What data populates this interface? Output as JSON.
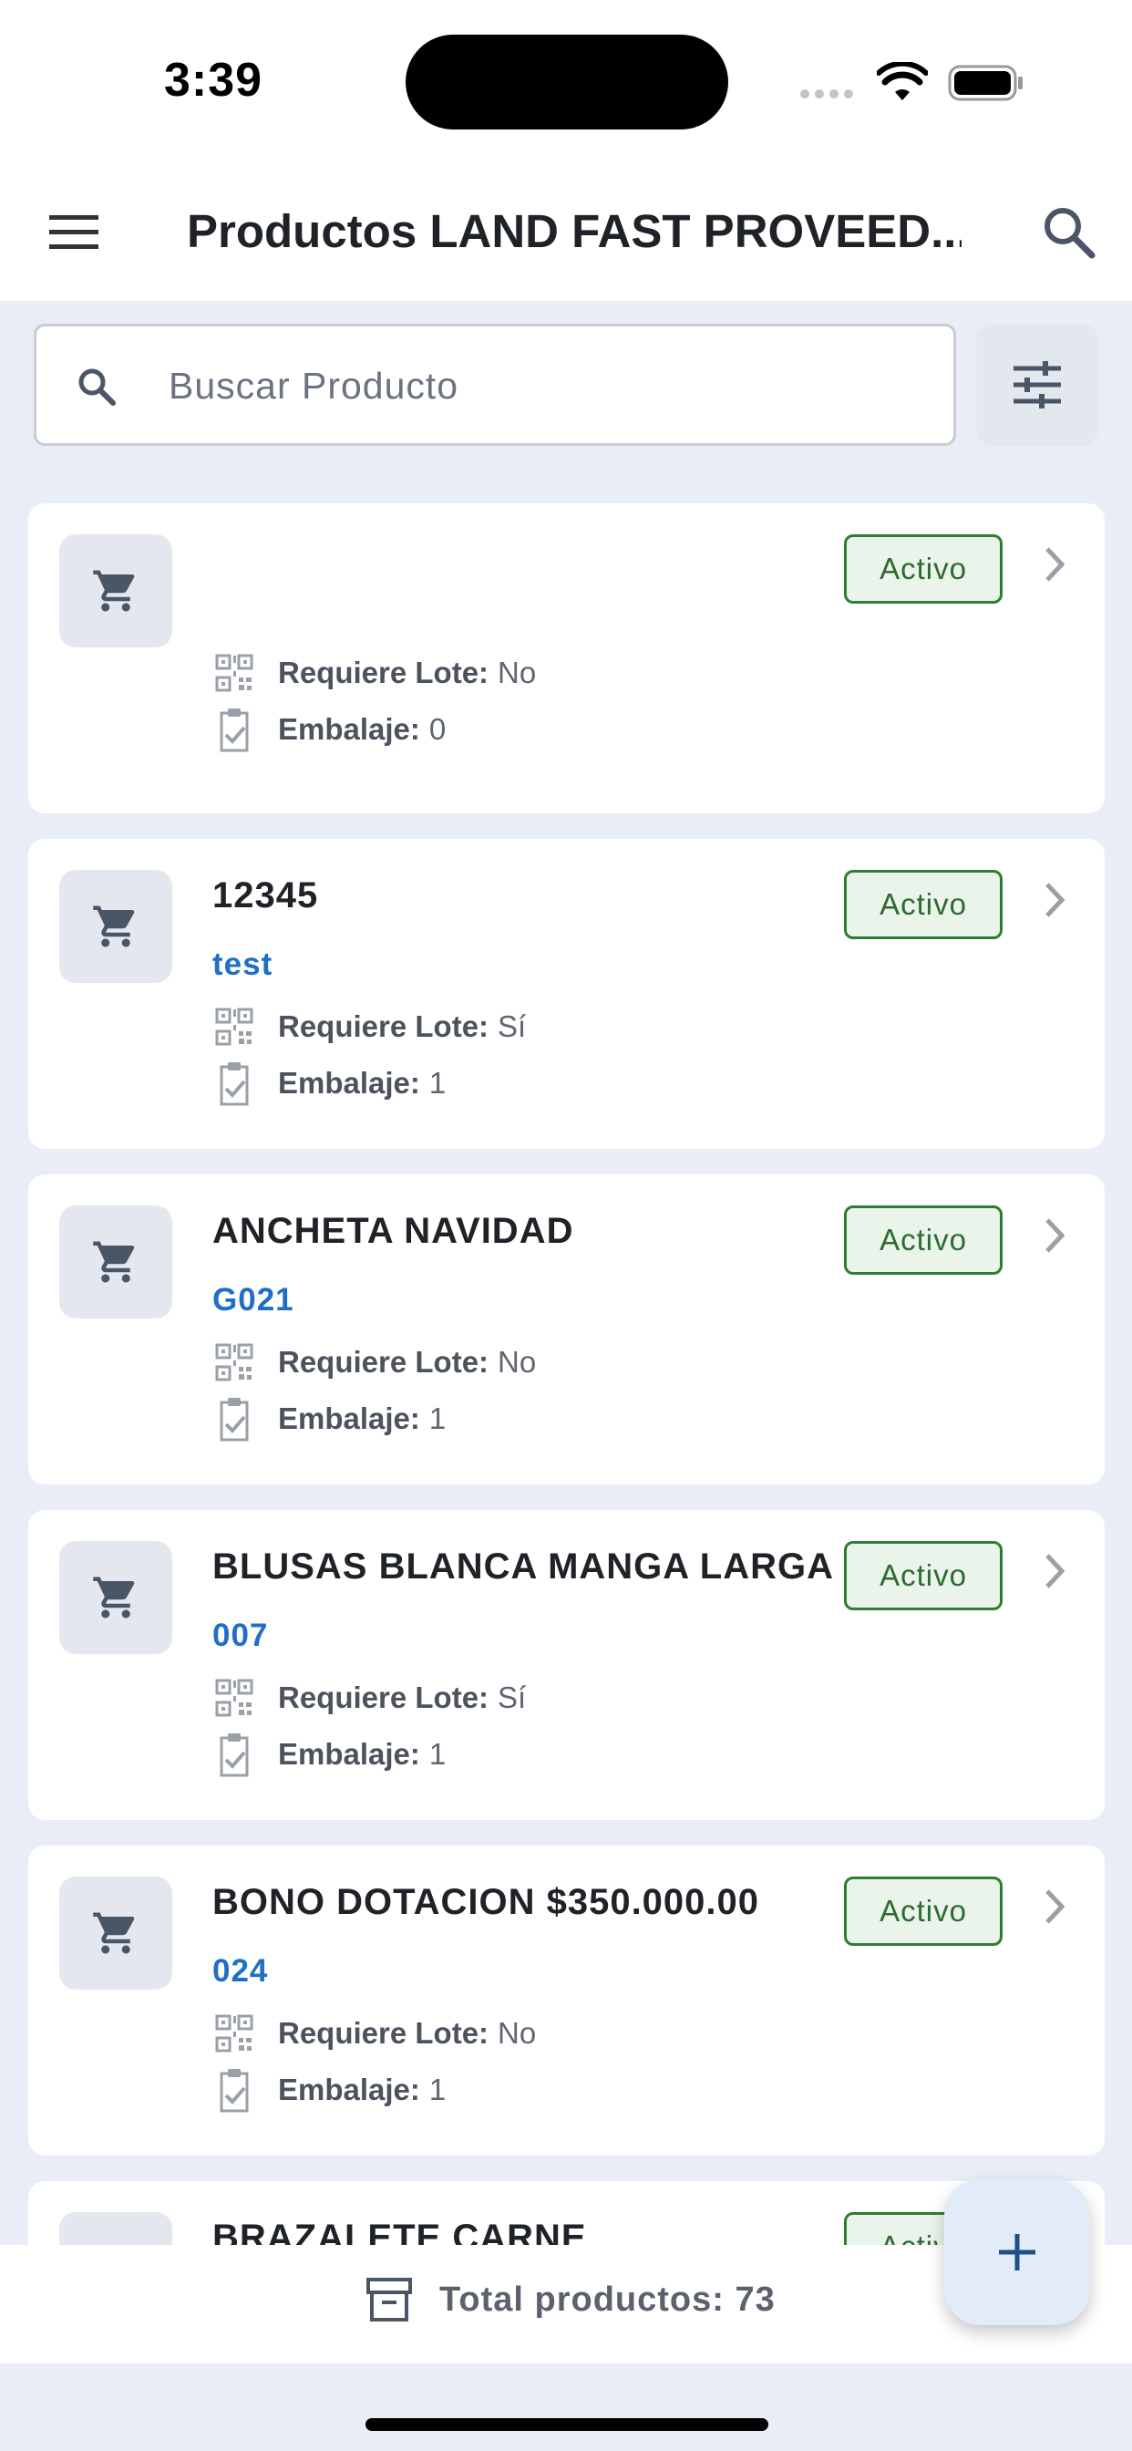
{
  "status_bar": {
    "time": "3:39"
  },
  "app_bar": {
    "title": "Productos LAND FAST PROVEED..."
  },
  "search": {
    "placeholder": "Buscar Producto"
  },
  "products": [
    {
      "name": "",
      "code": "",
      "status": "Activo",
      "requiere_lote_label": "Requiere Lote:",
      "requiere_lote": "No",
      "embalaje_label": "Embalaje:",
      "embalaje": "0"
    },
    {
      "name": "12345",
      "code": "test",
      "status": "Activo",
      "requiere_lote_label": "Requiere Lote:",
      "requiere_lote": "Sí",
      "embalaje_label": "Embalaje:",
      "embalaje": "1"
    },
    {
      "name": "ANCHETA NAVIDAD",
      "code": "G021",
      "status": "Activo",
      "requiere_lote_label": "Requiere Lote:",
      "requiere_lote": "No",
      "embalaje_label": "Embalaje:",
      "embalaje": "1"
    },
    {
      "name": "BLUSAS BLANCA MANGA LARGA",
      "code": "007",
      "status": "Activo",
      "requiere_lote_label": "Requiere Lote:",
      "requiere_lote": "Sí",
      "embalaje_label": "Embalaje:",
      "embalaje": "1"
    },
    {
      "name": "BONO DOTACION $350.000.00",
      "code": "024",
      "status": "Activo",
      "requiere_lote_label": "Requiere Lote:",
      "requiere_lote": "No",
      "embalaje_label": "Embalaje:",
      "embalaje": "1"
    },
    {
      "name": "BRAZALETE CARNE",
      "code": "",
      "status": "Activo",
      "requiere_lote_label": "",
      "requiere_lote": "",
      "embalaje_label": "",
      "embalaje": ""
    }
  ],
  "footer": {
    "total_label": "Total productos: 73"
  },
  "icons": {
    "menu": "menu-icon",
    "search": "search-icon",
    "filter": "filter-icon",
    "cart": "shopping-cart-icon",
    "qr": "qr-code-icon",
    "clipboard": "clipboard-check-icon",
    "chevron": "chevron-right-icon",
    "archive": "archive-box-icon",
    "add": "plus-icon"
  },
  "colors": {
    "accent_blue": "#1f6fc5",
    "active_green": "#2e7d32",
    "background": "#e9eef6"
  }
}
